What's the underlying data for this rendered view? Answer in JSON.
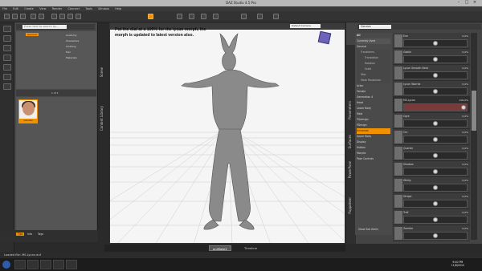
{
  "window": {
    "title": "DAZ Studio 4.5 Pro"
  },
  "menu": [
    "File",
    "Edit",
    "Create",
    "View",
    "Render",
    "Connect",
    "Tools",
    "Window",
    "Help"
  ],
  "left_panel": {
    "search_placeholder": "Enter text to search by...",
    "selected_category": "General",
    "tree_items": [
      "Anatomy",
      "Characters",
      "Clothing",
      "Hair",
      "Materials"
    ],
    "pager": "1 of 1",
    "thumbnail_label": "Genesis",
    "bottom_tabs": [
      "Tips",
      "Info",
      "Tags"
    ],
    "vertical_tabs": [
      "Content Library",
      "Scene"
    ]
  },
  "viewport": {
    "camera": "Default Camera",
    "note": "Put the dial at a 100% for the lycan morph, the morph is updated to latest version also."
  },
  "right_panel": {
    "selector": "Genesis",
    "vertical_tabs": [
      "Parameters",
      "Surfaces",
      "PowerPose",
      "Puppeteer"
    ],
    "categories": [
      "All",
      "Currently Used",
      "General",
      "Transforms",
      "Translation",
      "Rotation",
      "Scale",
      "Misc",
      "Mesh Resolution",
      "Actor",
      "Female",
      "Generation 4",
      "Head",
      "Lower Body",
      "Male",
      "PGdesign",
      "PDesign",
      "Universal",
      "Upper Body",
      "Display",
      "Hidden",
      "Morphs",
      "Pose Controls"
    ],
    "selected_category": "Universal",
    "morphs": [
      {
        "name": "Eve",
        "value": "0.0%",
        "fill": 0.0
      },
      {
        "name": "Goblin",
        "value": "0.0%",
        "fill": 0.0
      },
      {
        "name": "Lycan Smooth Neck",
        "value": "0.0%",
        "fill": 0.0
      },
      {
        "name": "Lycan Warrior",
        "value": "0.0%",
        "fill": 0.0
      },
      {
        "name": "MS-Lycan",
        "value": "100.0%",
        "fill": 1.0
      },
      {
        "name": "Ogre",
        "value": "0.0%",
        "fill": 0.0
      },
      {
        "name": "Orc",
        "value": "0.0%",
        "fill": 0.0
      },
      {
        "name": "Quarter",
        "value": "0.0%",
        "fill": 0.0
      },
      {
        "name": "Shadow",
        "value": "0.0%",
        "fill": 0.0
      },
      {
        "name": "Stinky",
        "value": "0.0%",
        "fill": 0.0
      },
      {
        "name": "Strigoi",
        "value": "0.0%",
        "fill": 0.0
      },
      {
        "name": "Troll",
        "value": "0.0%",
        "fill": 0.0
      },
      {
        "name": "Zombie",
        "value": "0.0%",
        "fill": 0.0
      }
    ],
    "show_sub_items": "Show Sub Items"
  },
  "bottom_tabs": [
    "aniMate2",
    "Timeline"
  ],
  "status": "Loaded file: MS-Lycan.duf",
  "clock": {
    "time": "9:40 PM",
    "date": "11/6/2012"
  }
}
